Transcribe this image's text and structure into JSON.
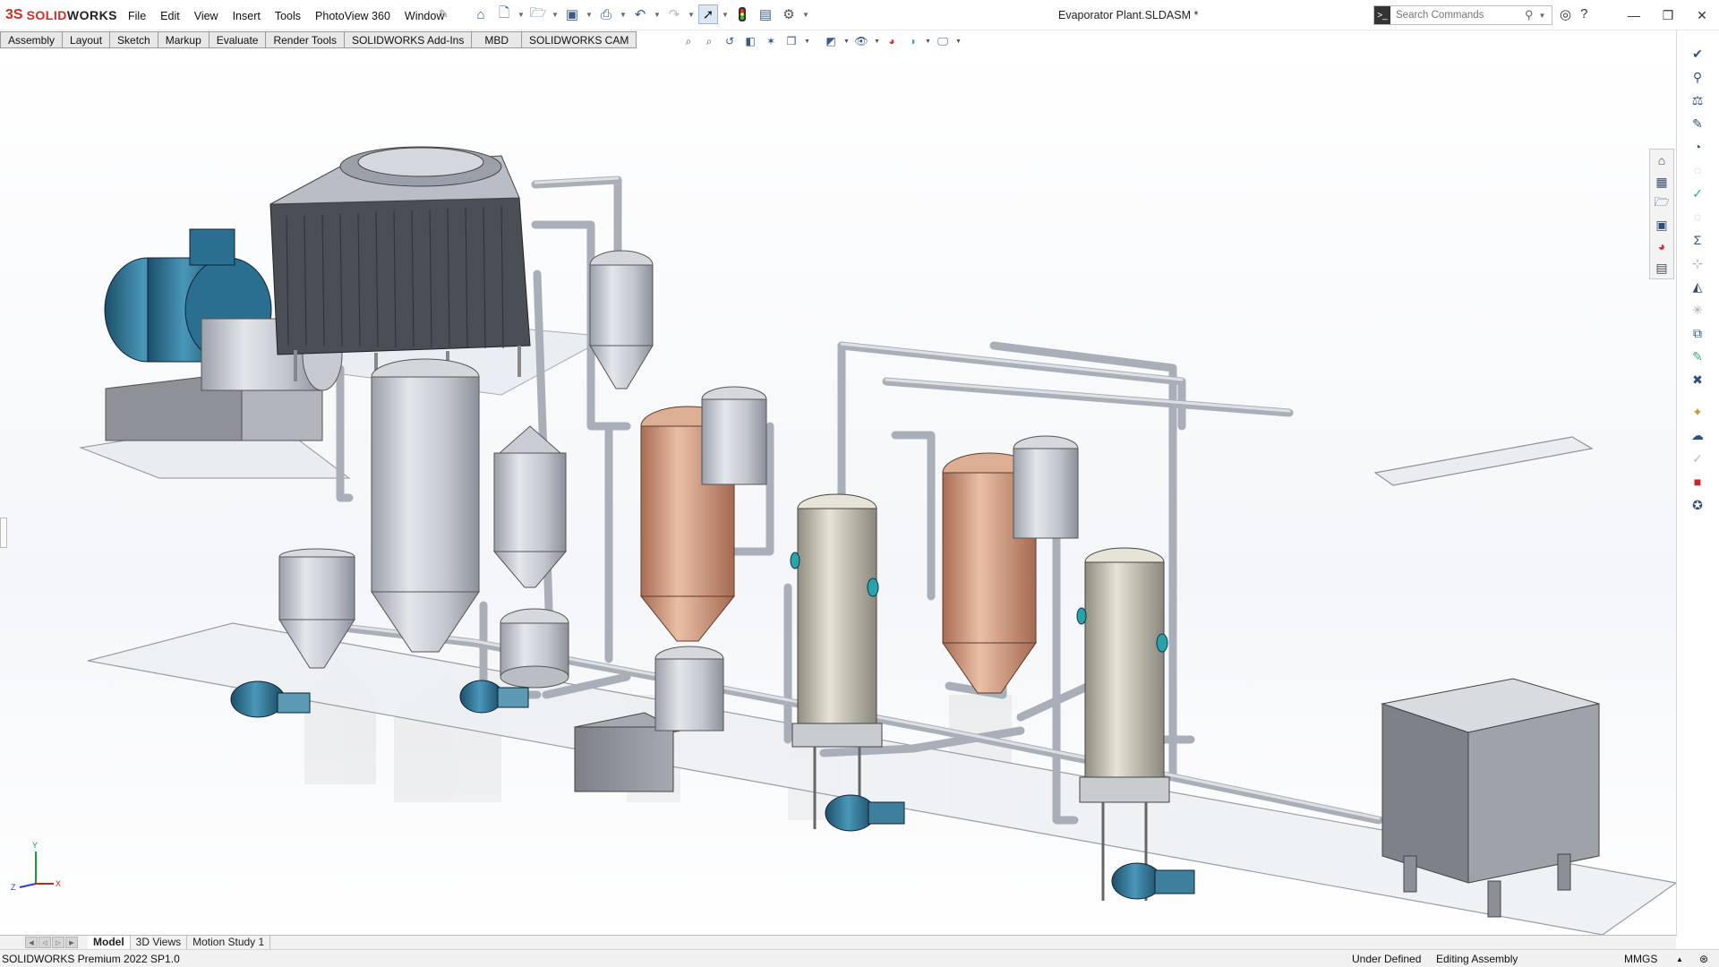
{
  "app": {
    "logo_mark": "3S",
    "logo_brand": "SOLID",
    "logo_brand2": "WORKS"
  },
  "menu": [
    "File",
    "Edit",
    "View",
    "Insert",
    "Tools",
    "PhotoView 360",
    "Window"
  ],
  "quick_access": [
    "home-icon",
    "new-document-icon",
    "open-folder-icon",
    "save-icon",
    "print-icon",
    "undo-icon",
    "redo-icon",
    "select-arrow-icon",
    "traffic-light-icon",
    "file-properties-icon",
    "options-gear-icon"
  ],
  "document_title": "Evaporator Plant.SLDASM *",
  "search": {
    "placeholder": "Search Commands"
  },
  "command_tabs": [
    "Assembly",
    "Layout",
    "Sketch",
    "Markup",
    "Evaluate",
    "Render Tools",
    "SOLIDWORKS Add-Ins",
    "MBD",
    "SOLIDWORKS CAM"
  ],
  "bottom_tabs": [
    "Model",
    "3D Views",
    "Motion Study 1"
  ],
  "status": {
    "version": "SOLIDWORKS Premium 2022 SP1.0",
    "definition": "Under Defined",
    "mode": "Editing Assembly",
    "units": "MMGS"
  },
  "triad": {
    "x": "X",
    "y": "Y",
    "z": "Z"
  },
  "colors": {
    "accent": "#d52b1e",
    "copper": "#c98a6a",
    "steel": "#c3c8d0",
    "motor_blue": "#2a6f8f"
  }
}
